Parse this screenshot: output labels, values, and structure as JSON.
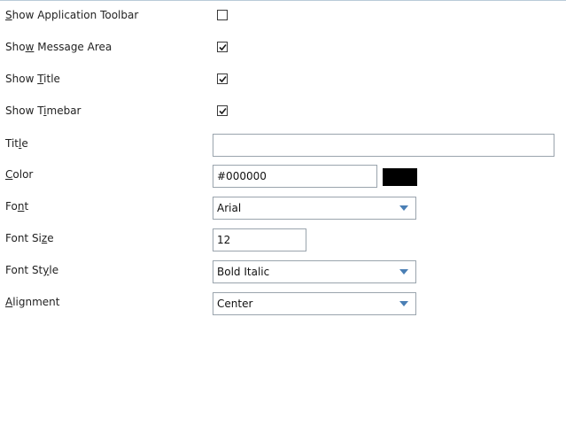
{
  "fields": {
    "show_application_toolbar": {
      "label_pre": "",
      "label_key": "S",
      "label_post": "how Application Toolbar",
      "checked": false
    },
    "show_message_area": {
      "label_pre": "Sho",
      "label_key": "w",
      "label_post": " Message Area",
      "checked": true
    },
    "show_title": {
      "label_pre": "Show ",
      "label_key": "T",
      "label_post": "itle",
      "checked": true
    },
    "show_timebar": {
      "label_pre": "Show T",
      "label_key": "i",
      "label_post": "mebar",
      "checked": true
    },
    "title": {
      "label_pre": "Tit",
      "label_key": "l",
      "label_post": "e",
      "value": ""
    },
    "color": {
      "label_pre": "",
      "label_key": "C",
      "label_post": "olor",
      "value": "#000000",
      "swatch": "#000000"
    },
    "font": {
      "label_pre": "Fo",
      "label_key": "n",
      "label_post": "t",
      "value": "Arial"
    },
    "font_size": {
      "label_pre": "Font Si",
      "label_key": "z",
      "label_post": "e",
      "value": "12"
    },
    "font_style": {
      "label_pre": "Font St",
      "label_key": "y",
      "label_post": "le",
      "value": "Bold Italic"
    },
    "alignment": {
      "label_pre": "",
      "label_key": "A",
      "label_post": "lignment",
      "value": "Center"
    }
  },
  "icons": {
    "dropdown": "chevron-down-icon",
    "check": "checkmark-icon"
  }
}
